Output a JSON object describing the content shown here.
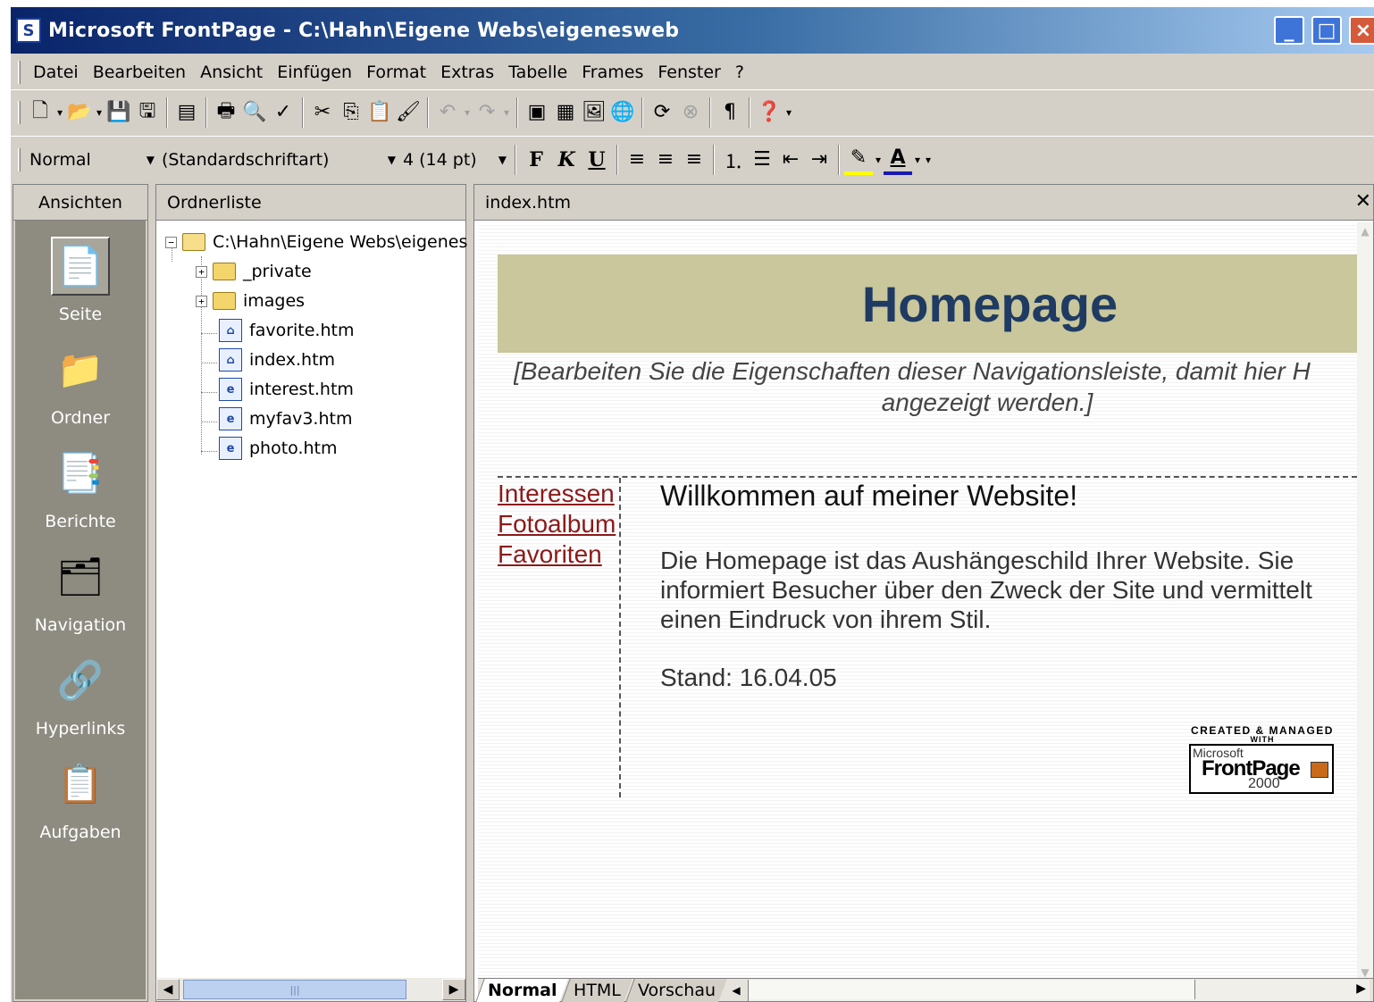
{
  "window": {
    "title": "Microsoft FrontPage - C:\\Hahn\\Eigene Webs\\eigenesweb",
    "controls": {
      "minimize": "_",
      "maximize": "□",
      "close": "×"
    }
  },
  "menu": [
    "Datei",
    "Bearbeiten",
    "Ansicht",
    "Einfügen",
    "Format",
    "Extras",
    "Tabelle",
    "Frames",
    "Fenster",
    "?"
  ],
  "toolbar_standard": [
    "new-page-icon",
    "open-icon",
    "save-icon",
    "publish-icon",
    "folder-list-icon",
    "print-icon",
    "print-preview-icon",
    "spelling-icon",
    "cut-icon",
    "copy-icon",
    "paste-icon",
    "format-painter-icon",
    "undo-icon",
    "redo-icon",
    "insert-component-icon",
    "insert-table-icon",
    "insert-picture-icon",
    "hyperlink-icon",
    "refresh-icon",
    "stop-icon",
    "show-all-icon",
    "help-icon"
  ],
  "toolbar_format": {
    "style": "Normal",
    "font": "(Standardschriftart)",
    "size": "4  (14 pt)",
    "bold": "F",
    "italic": "K",
    "underline": "U"
  },
  "views": {
    "header": "Ansichten",
    "items": [
      {
        "label": "Seite",
        "icon": "page-view-icon",
        "active": true
      },
      {
        "label": "Ordner",
        "icon": "folders-view-icon"
      },
      {
        "label": "Berichte",
        "icon": "reports-view-icon"
      },
      {
        "label": "Navigation",
        "icon": "navigation-view-icon"
      },
      {
        "label": "Hyperlinks",
        "icon": "hyperlinks-view-icon"
      },
      {
        "label": "Aufgaben",
        "icon": "tasks-view-icon"
      }
    ]
  },
  "folder_list": {
    "header": "Ordnerliste",
    "root": "C:\\Hahn\\Eigene Webs\\eigenes",
    "items": [
      "_private",
      "images",
      "favorite.htm",
      "index.htm",
      "interest.htm",
      "myfav3.htm",
      "photo.htm"
    ]
  },
  "editor": {
    "tab_title": "index.htm",
    "banner": "Homepage",
    "nav_note_line1": "[Bearbeiten Sie die Eigenschaften dieser Navigationsleiste, damit hier H",
    "nav_note_line2": "angezeigt werden.]",
    "links": [
      "Interessen",
      "Fotoalbum",
      "Favoriten"
    ],
    "welcome": "Willkommen auf meiner Website!",
    "body": "Die Homepage ist das Aushängeschild Ihrer Website. Sie informiert Besucher über den Zweck der Site und vermittelt einen Eindruck von ihrem Stil.",
    "stand": "Stand: 16.04.05",
    "logo": {
      "caption": "CREATED & MANAGED",
      "with": "WITH",
      "microsoft": "Microsoft",
      "product": "FrontPage",
      "year": "2000"
    },
    "view_tabs": [
      "Normal",
      "HTML",
      "Vorschau"
    ]
  },
  "colors": {
    "banner_bg": "#c9c79b",
    "banner_text": "#1f3b63",
    "link": "#8b1a1a",
    "views_bg": "#8e8b80"
  }
}
